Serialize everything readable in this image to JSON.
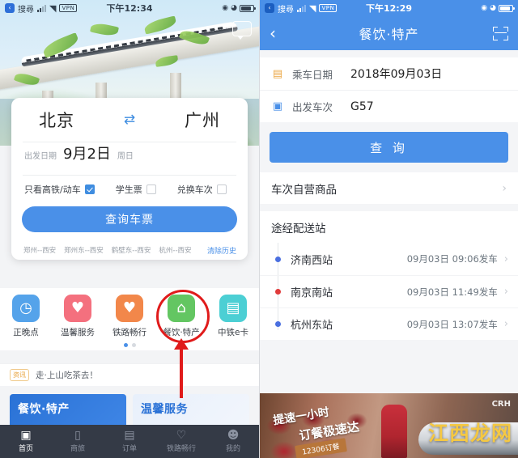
{
  "left": {
    "statusbar": {
      "back_label": "搜尋",
      "time": "下午12:34",
      "vpn": "VPN"
    },
    "hero": {
      "chat_icon": "chat-icon"
    },
    "search_card": {
      "from_city": "北京",
      "swap_icon": "swap-arrows-icon",
      "to_city": "广州",
      "date_label": "出发日期",
      "date_value": "9月2日",
      "weekday": "周日",
      "options": [
        {
          "label": "只看高铁/动车",
          "checked": true
        },
        {
          "label": "学生票",
          "checked": false
        },
        {
          "label": "兑换车次",
          "checked": false
        }
      ],
      "submit_label": "查询车票",
      "history": [
        "郑州--西安",
        "郑州东--西安",
        "鹤壁东--西安",
        "杭州--西安"
      ],
      "clear_history_label": "清除历史"
    },
    "shortcuts": [
      {
        "label": "正晚点",
        "icon": "clock-icon",
        "glyph": "◷",
        "color": "#55a3ea"
      },
      {
        "label": "温馨服务",
        "icon": "heart-icon",
        "glyph": "♥",
        "color": "#f4707e"
      },
      {
        "label": "铁路畅行",
        "icon": "shield-heart-icon",
        "glyph": "♥",
        "color": "#f2874a"
      },
      {
        "label": "餐饮·特产",
        "icon": "food-cloche-icon",
        "glyph": "⛱",
        "color": "#63c662"
      },
      {
        "label": "中铁e卡",
        "icon": "card-icon",
        "glyph": "▤",
        "color": "#4ccfd4"
      }
    ],
    "pager": {
      "total": 2,
      "active": 1
    },
    "notice": {
      "badge": "资讯",
      "text": "走·上山吃茶去！"
    },
    "promos": [
      {
        "title": "餐饮·特产"
      },
      {
        "title": "温馨服务"
      }
    ],
    "tabbar": [
      {
        "label": "首页",
        "icon": "home-train-icon",
        "glyph": "🚆",
        "active": true
      },
      {
        "label": "商旅",
        "icon": "briefcase-icon",
        "glyph": "🗑",
        "active": false
      },
      {
        "label": "订单",
        "icon": "order-list-icon",
        "glyph": "📋",
        "active": false
      },
      {
        "label": "铁路畅行",
        "icon": "shield-heart-icon",
        "glyph": "♡",
        "active": false
      },
      {
        "label": "我的",
        "icon": "user-icon",
        "glyph": "👤",
        "active": false
      }
    ]
  },
  "right": {
    "statusbar": {
      "back_label": "搜尋",
      "time": "下午12:29",
      "vpn": "VPN"
    },
    "header": {
      "back_icon": "chevron-left-icon",
      "title": "餐饮·特产",
      "scan_icon": "scan-qr-icon"
    },
    "form": [
      {
        "icon": "calendar-icon",
        "label": "乘车日期",
        "value": "2018年09月03日"
      },
      {
        "icon": "train-icon",
        "label": "出发车次",
        "value": "G57"
      }
    ],
    "query_label": "查 询",
    "sections": [
      {
        "title": "车次自营商品",
        "chevron": true
      },
      {
        "title": "途经配送站",
        "chevron": false
      }
    ],
    "stations": [
      {
        "name": "济南西站",
        "time": "09月03日 09:06发车",
        "dot_color": "#4a6fe0"
      },
      {
        "name": "南京南站",
        "time": "09月03日 11:49发车",
        "dot_color": "#e03b3b"
      },
      {
        "name": "杭州东站",
        "time": "09月03日 13:07发车",
        "dot_color": "#4a6fe0"
      }
    ],
    "banner": {
      "line1": "提速一小时",
      "line2": "订餐极速达",
      "tag": "12306订餐",
      "logo": "CRH",
      "watermark": "江西龙网"
    }
  },
  "colors": {
    "accent": "#4a90e8",
    "annotation": "#e01b1b",
    "tabbar_bg": "#343a46"
  }
}
